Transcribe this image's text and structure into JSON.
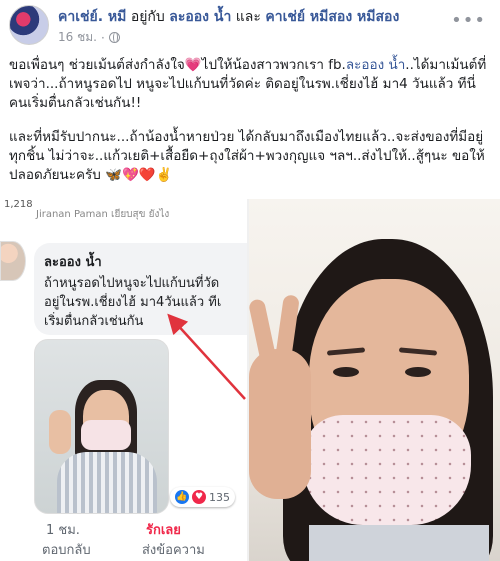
{
  "post": {
    "author": "คาเช่ย์. หมี",
    "with_text": " อยู่กับ ",
    "with_person": "ละออง น้ำ",
    "and_text": " และ ",
    "with_person2": "คาเช่ย์ หมีสอง หมีสอง",
    "time": "16 ชม.",
    "more_icon": "more-dots-icon",
    "paragraph1_a": "ขอเพื่อนๆ ช่วยเม้นต์ส่งกำลังใจ",
    "paragraph1_heart": "💗",
    "paragraph1_b": "ไปให้น้องสาวพวกเรา fb.",
    "paragraph1_link": "ละออง น้ำ",
    "paragraph1_c": "..ได้มาเม้นต์ที่เพจว่า...ถ้าหนูรอดไป หนูจะไปแก้บนที่วัดค่ะ ติดอยู่ในรพ.เชี่ยงไฮ้ มา4 วันแล้ว ทีนี่คนเริ่มตื่นกลัวเช่นกัน!!",
    "paragraph2": "และที่หมีรับปากนะ...ถ้าน้องน้ำหายป่วย ได้กลับมาถึงเมืองไทยแล้ว..จะส่งของที่มีอยู่ทุกชิ้น ไม่ว่าจะ..แก้วเยติ+เสื้อยืด+ถุงใส่ผ้า+พวงกุญแจ ฯลฯ..ส่งไปให้..สู้ๆนะ ขอให้ปลอดภัยนะครับ 🦋💖❤️✌️"
  },
  "screenshot": {
    "top_count": "1,218",
    "cut_name": "Jiranan Paman  เยียบสุข ยังไง",
    "commenter": "ละออง น้ำ",
    "comment_line1": "ถ้าหนูรอดไปหนูจะไปแก้บนที่วัด",
    "comment_line2": "อยู่ในรพ.เชี่ยงไฮ้ มา4วันแล้ว ทีเ",
    "comment_line3": "เริ่มตื่นกลัวเช่นกัน",
    "reaction_count": "135",
    "like_icon": "like-icon",
    "love_icon": "love-icon",
    "time": "1 ชม.",
    "love_action": "รักเลย",
    "reply": "ตอบกลับ",
    "send": "ส่งข้อความ"
  },
  "colors": {
    "link": "#385898",
    "love": "#f0284a",
    "like": "#1877f2",
    "arrow": "#e0333d"
  }
}
